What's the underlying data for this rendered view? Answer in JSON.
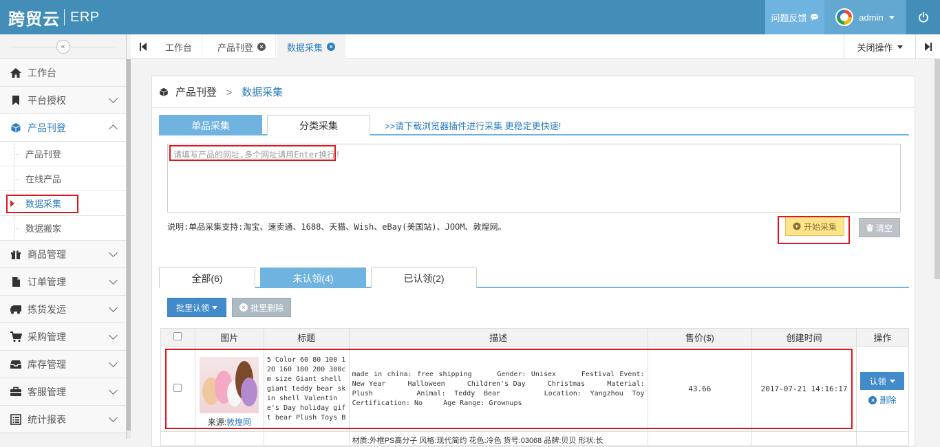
{
  "header": {
    "logo_cn": "跨贸云",
    "logo_en": "ERP",
    "feedback": "问题反馈",
    "user": "admin"
  },
  "sidebar": {
    "items": [
      {
        "label": "工作台",
        "icon": "home-icon"
      },
      {
        "label": "平台授权",
        "icon": "bookmark-icon"
      },
      {
        "label": "产品刊登",
        "icon": "cube-icon"
      },
      {
        "label": "商品管理",
        "icon": "gift-icon"
      },
      {
        "label": "订单管理",
        "icon": "file-icon"
      },
      {
        "label": "拣货发运",
        "icon": "truck-icon"
      },
      {
        "label": "采购管理",
        "icon": "cart-icon"
      },
      {
        "label": "库存管理",
        "icon": "inbox-icon"
      },
      {
        "label": "客服管理",
        "icon": "briefcase-icon"
      },
      {
        "label": "统计报表",
        "icon": "list-icon"
      }
    ],
    "sub_items": [
      "产品刊登",
      "在线产品",
      "数据采集",
      "数据搬家"
    ]
  },
  "tabs": {
    "items": [
      "工作台",
      "产品刊登",
      "数据采集"
    ],
    "close_ops": "关闭操作"
  },
  "breadcrumb": {
    "parent": "产品刊登",
    "sep": ">",
    "current": "数据采集"
  },
  "collect": {
    "tab_single": "单品采集",
    "tab_category": "分类采集",
    "plugin_link": ">>请下载浏览器插件进行采集 更稳定更快速!",
    "placeholder": "请填写产品的网址,多个网址请用Enter换行!",
    "hint": "说明:单品采集支持:淘宝、速卖通、1688、天猫、Wish、eBay(美国站)、JOOM、敦煌网。",
    "start": "开始采集",
    "clear": "清空"
  },
  "filter_tabs": {
    "all": "全部(6)",
    "unclaimed": "未认领(4)",
    "claimed": "已认领(2)"
  },
  "bulk": {
    "claim": "批里认领",
    "delete": "批里删除"
  },
  "table": {
    "headers": [
      "图片",
      "标题",
      "描述",
      "售价($)",
      "创建时间",
      "操作"
    ],
    "rows": [
      {
        "source_label": "来源:",
        "source_name": "敦煌网",
        "title": "5 Color 60 80 100 120 160 180 200 300cm size Giant shell giant teddy bear skin shell Valentine's Day holiday gift bear Plush Toys B",
        "desc": "made in china: free shipping     Gender: Unisex     Festival Event: New Year     Halloween     Children's Day     Christmas     Material: Plush     Animal: Teddy Bear     Location: Yangzhou Toy     Certification: No     Age Range: Grownups",
        "price": "43.66",
        "created": "2017-07-21 14:16:17",
        "claim": "认领",
        "delete": "删除"
      }
    ],
    "row2_desc": "材质:外框PS高分子  风格:现代简约  花色:冷色  货号:03068  品牌:贝贝  形状:长"
  }
}
